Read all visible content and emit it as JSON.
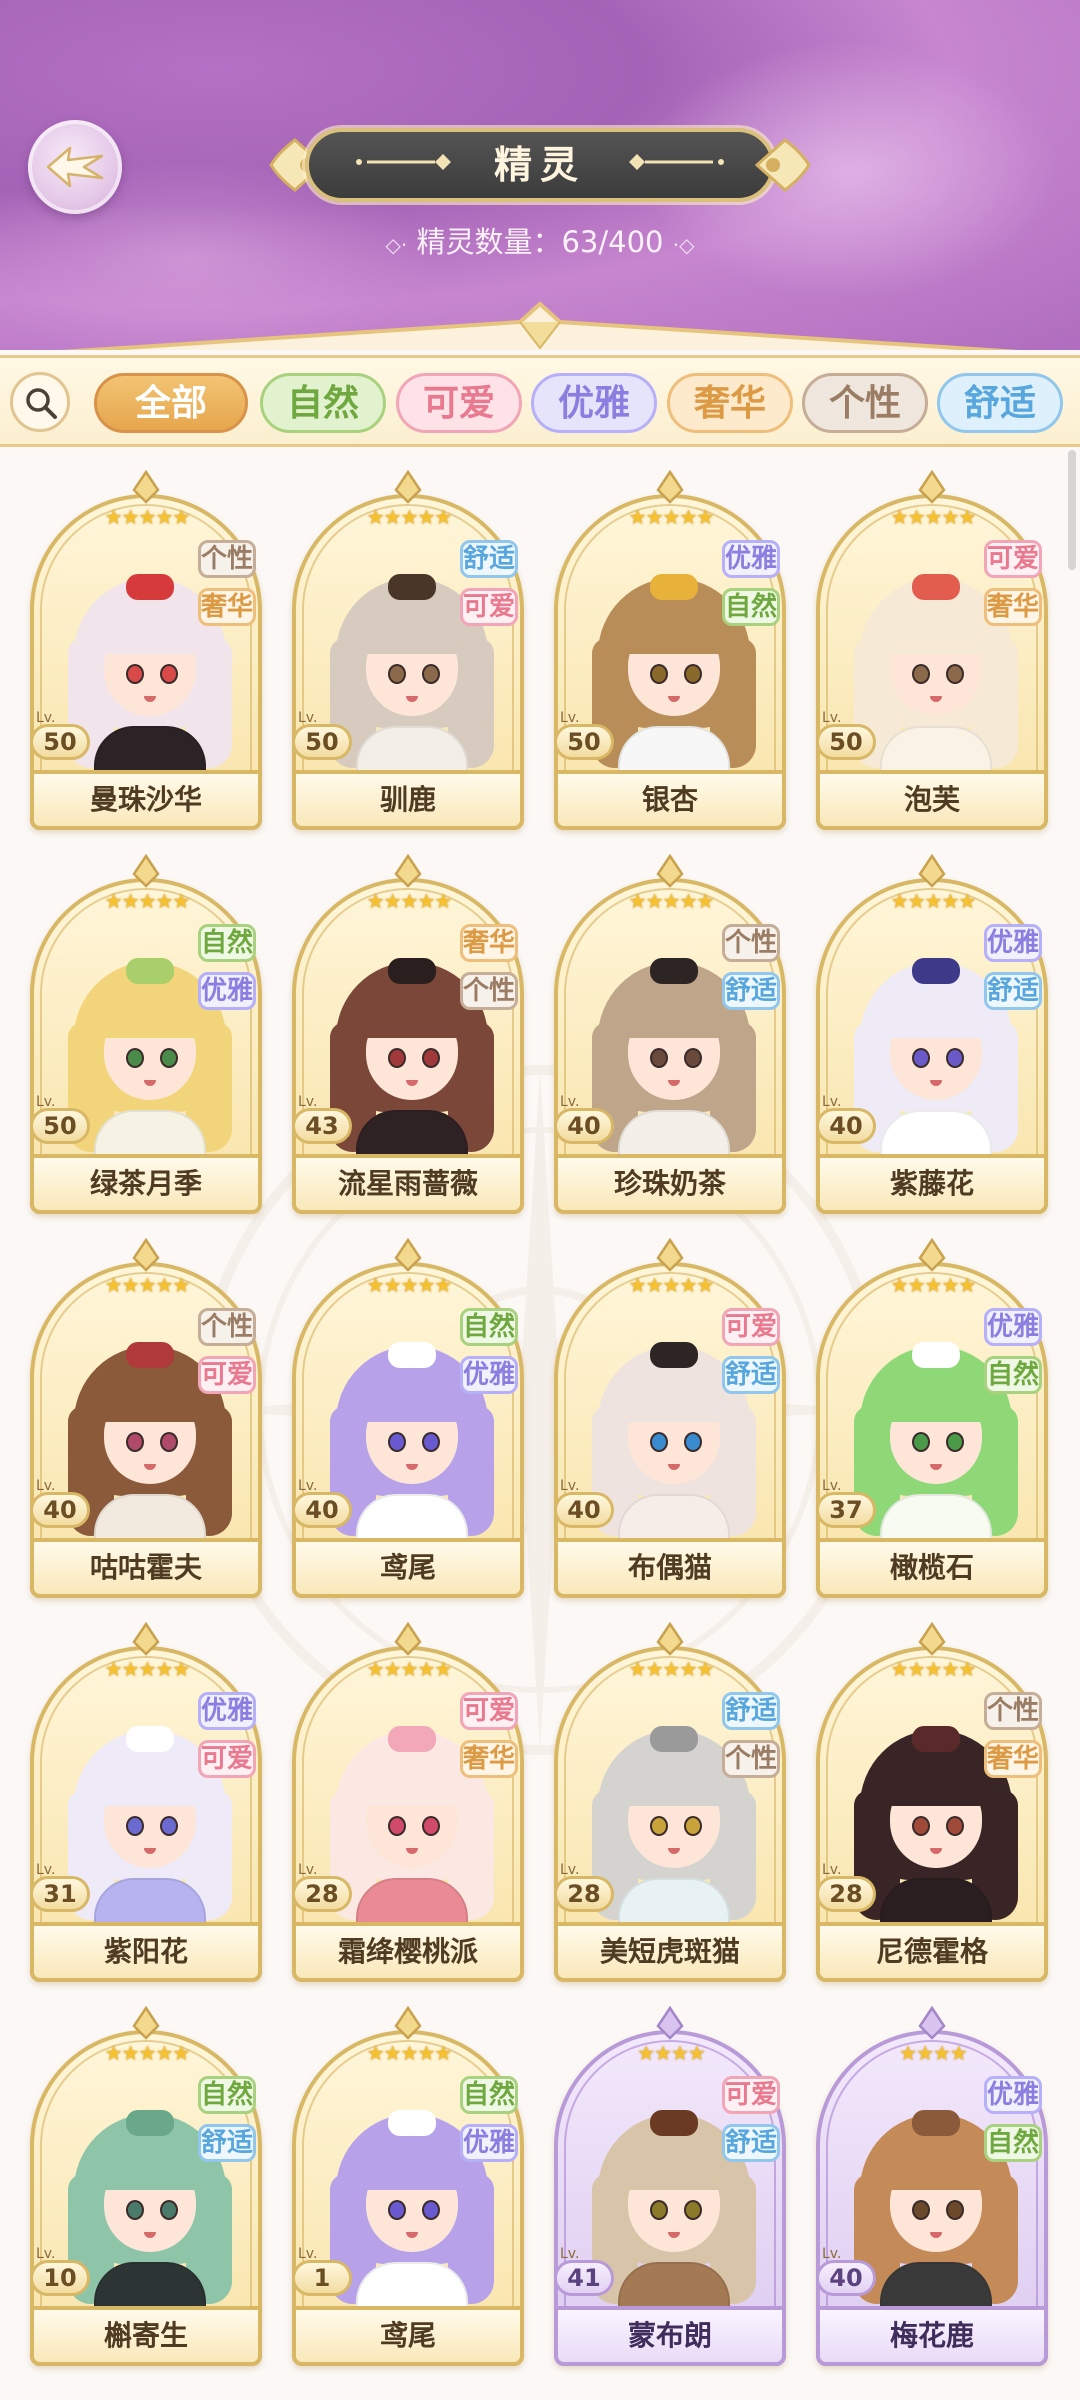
{
  "header": {
    "title": "精灵",
    "count_label": "精灵数量：63/400"
  },
  "filters": [
    {
      "label": "全部",
      "style": "all",
      "selected": true
    },
    {
      "label": "自然",
      "style": "nature",
      "selected": false
    },
    {
      "label": "可爱",
      "style": "cute",
      "selected": false
    },
    {
      "label": "优雅",
      "style": "elegant",
      "selected": false
    },
    {
      "label": "奢华",
      "style": "lux",
      "selected": false
    },
    {
      "label": "个性",
      "style": "persona",
      "selected": false
    },
    {
      "label": "舒适",
      "style": "comfy",
      "selected": false
    }
  ],
  "level_prefix": "Lv.",
  "colors": {
    "gold_frame": "#d8b765",
    "purple_frame": "#b99ad8",
    "star": "#f6c12e",
    "header_purple": "#b571c4"
  },
  "cards": [
    {
      "name": "曼珠沙华",
      "level": "50",
      "stars": 5,
      "tags": [
        {
          "label": "个性",
          "style": "persona"
        },
        {
          "label": "奢华",
          "style": "lux"
        }
      ],
      "frame": "gold",
      "hair": "#f1e4ea",
      "body": "#2c2326",
      "acc": "#d63a3a",
      "eyes": "#d84a4a"
    },
    {
      "name": "驯鹿",
      "level": "50",
      "stars": 5,
      "tags": [
        {
          "label": "舒适",
          "style": "comfy"
        },
        {
          "label": "可爱",
          "style": "cute"
        }
      ],
      "frame": "gold",
      "hair": "#d7cbbf",
      "body": "#f3eee6",
      "acc": "#4a3628",
      "eyes": "#8a6a4a"
    },
    {
      "name": "银杏",
      "level": "50",
      "stars": 5,
      "tags": [
        {
          "label": "优雅",
          "style": "elegant"
        },
        {
          "label": "自然",
          "style": "nature"
        }
      ],
      "frame": "gold",
      "hair": "#b98d58",
      "body": "#f7f7f7",
      "acc": "#e8b13a",
      "eyes": "#8a6a2a"
    },
    {
      "name": "泡芙",
      "level": "50",
      "stars": 5,
      "tags": [
        {
          "label": "可爱",
          "style": "cute"
        },
        {
          "label": "奢华",
          "style": "lux"
        }
      ],
      "frame": "gold",
      "hair": "#f6ead7",
      "body": "#fbf2e6",
      "acc": "#e35d4e",
      "eyes": "#8a6a4a"
    },
    {
      "name": "绿茶月季",
      "level": "50",
      "stars": 5,
      "tags": [
        {
          "label": "自然",
          "style": "nature"
        },
        {
          "label": "优雅",
          "style": "elegant"
        }
      ],
      "frame": "gold",
      "hair": "#f2d47a",
      "body": "#f7f3e4",
      "acc": "#a9cf6a",
      "eyes": "#4a8a4a"
    },
    {
      "name": "流星雨蔷薇",
      "level": "43",
      "stars": 5,
      "tags": [
        {
          "label": "奢华",
          "style": "lux"
        },
        {
          "label": "个性",
          "style": "persona"
        }
      ],
      "frame": "gold",
      "hair": "#7b4738",
      "body": "#2f2224",
      "acc": "#2a1e1e",
      "eyes": "#a03a3a"
    },
    {
      "name": "珍珠奶茶",
      "level": "40",
      "stars": 5,
      "tags": [
        {
          "label": "个性",
          "style": "persona"
        },
        {
          "label": "舒适",
          "style": "comfy"
        }
      ],
      "frame": "gold",
      "hair": "#bfa58a",
      "body": "#f4efe9",
      "acc": "#2d2424",
      "eyes": "#6a4a3a"
    },
    {
      "name": "紫藤花",
      "level": "40",
      "stars": 5,
      "tags": [
        {
          "label": "优雅",
          "style": "elegant"
        },
        {
          "label": "舒适",
          "style": "comfy"
        }
      ],
      "frame": "gold",
      "hair": "#eeeaf6",
      "body": "#ffffff",
      "acc": "#3e3a8a",
      "eyes": "#6a5ac8"
    },
    {
      "name": "咕咕霍夫",
      "level": "40",
      "stars": 5,
      "tags": [
        {
          "label": "个性",
          "style": "persona"
        },
        {
          "label": "可爱",
          "style": "cute"
        }
      ],
      "frame": "gold",
      "hair": "#8a5a3a",
      "body": "#f3eadf",
      "acc": "#b03a3a",
      "eyes": "#b04a6a"
    },
    {
      "name": "鸢尾",
      "level": "40",
      "stars": 5,
      "tags": [
        {
          "label": "自然",
          "style": "nature"
        },
        {
          "label": "优雅",
          "style": "elegant"
        }
      ],
      "frame": "gold",
      "hair": "#b7a2ea",
      "body": "#ffffff",
      "acc": "#ffffff",
      "eyes": "#6a5ad0"
    },
    {
      "name": "布偶猫",
      "level": "40",
      "stars": 5,
      "tags": [
        {
          "label": "可爱",
          "style": "cute"
        },
        {
          "label": "舒适",
          "style": "comfy"
        }
      ],
      "frame": "gold",
      "hair": "#efe3e0",
      "body": "#f6ece8",
      "acc": "#2d2424",
      "eyes": "#3a8ad0"
    },
    {
      "name": "橄榄石",
      "level": "37",
      "stars": 5,
      "tags": [
        {
          "label": "优雅",
          "style": "elegant"
        },
        {
          "label": "自然",
          "style": "nature"
        }
      ],
      "frame": "gold",
      "hair": "#8ed878",
      "body": "#f7fbf1",
      "acc": "#ffffff",
      "eyes": "#4a9a4a"
    },
    {
      "name": "紫阳花",
      "level": "31",
      "stars": 5,
      "tags": [
        {
          "label": "优雅",
          "style": "elegant"
        },
        {
          "label": "可爱",
          "style": "cute"
        }
      ],
      "frame": "gold",
      "hair": "#eeeaf8",
      "body": "#b7b3f0",
      "acc": "#ffffff",
      "eyes": "#6a6ad0"
    },
    {
      "name": "霜绛樱桃派",
      "level": "28",
      "stars": 5,
      "tags": [
        {
          "label": "可爱",
          "style": "cute"
        },
        {
          "label": "奢华",
          "style": "lux"
        }
      ],
      "frame": "gold",
      "hair": "#fbe8e2",
      "body": "#e98a94",
      "acc": "#f2a8b8",
      "eyes": "#d04a6a"
    },
    {
      "name": "美短虎斑猫",
      "level": "28",
      "stars": 5,
      "tags": [
        {
          "label": "舒适",
          "style": "comfy"
        },
        {
          "label": "个性",
          "style": "persona"
        }
      ],
      "frame": "gold",
      "hair": "#d4d3d0",
      "body": "#e8f2f4",
      "acc": "#9a9a9a",
      "eyes": "#c8a23a"
    },
    {
      "name": "尼德霍格",
      "level": "28",
      "stars": 5,
      "tags": [
        {
          "label": "个性",
          "style": "persona"
        },
        {
          "label": "奢华",
          "style": "lux"
        }
      ],
      "frame": "gold",
      "hair": "#3a2526",
      "body": "#2a1e20",
      "acc": "#5a2a2a",
      "eyes": "#a04a3a"
    },
    {
      "name": "槲寄生",
      "level": "10",
      "stars": 5,
      "tags": [
        {
          "label": "自然",
          "style": "nature"
        },
        {
          "label": "舒适",
          "style": "comfy"
        }
      ],
      "frame": "gold",
      "hair": "#8ec4a8",
      "body": "#2d3434",
      "acc": "#6aa88a",
      "eyes": "#4a7a6a"
    },
    {
      "name": "鸢尾",
      "level": "1",
      "stars": 5,
      "tags": [
        {
          "label": "自然",
          "style": "nature"
        },
        {
          "label": "优雅",
          "style": "elegant"
        }
      ],
      "frame": "gold",
      "hair": "#b7a2ea",
      "body": "#ffffff",
      "acc": "#ffffff",
      "eyes": "#6a5ad0"
    },
    {
      "name": "蒙布朗",
      "level": "41",
      "stars": 4,
      "tags": [
        {
          "label": "可爱",
          "style": "cute"
        },
        {
          "label": "舒适",
          "style": "comfy"
        }
      ],
      "frame": "purple",
      "hair": "#d8c4a8",
      "body": "#a37a54",
      "acc": "#6a3a22",
      "eyes": "#8a7a2a"
    },
    {
      "name": "梅花鹿",
      "level": "40",
      "stars": 4,
      "tags": [
        {
          "label": "优雅",
          "style": "elegant"
        },
        {
          "label": "自然",
          "style": "nature"
        }
      ],
      "frame": "purple",
      "hair": "#c48a58",
      "body": "#3a3a3a",
      "acc": "#8a5a3a",
      "eyes": "#6a4a2a"
    }
  ]
}
